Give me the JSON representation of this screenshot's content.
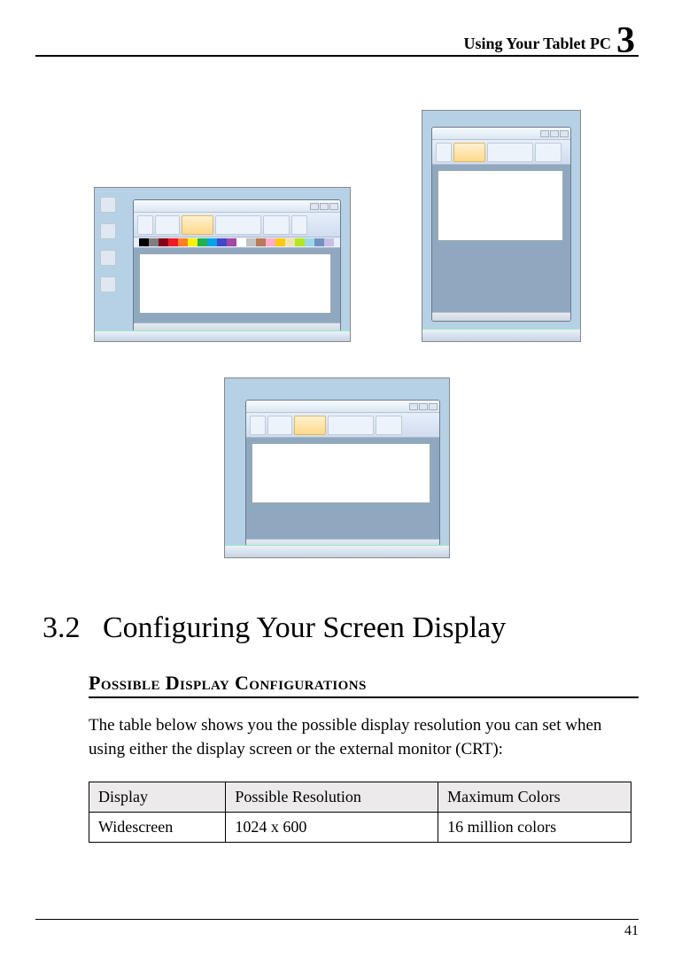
{
  "header": {
    "title": "Using Your Tablet PC",
    "chapter": "3"
  },
  "section": {
    "number": "3.2",
    "title": "Configuring Your Screen Display"
  },
  "subsection": {
    "heading": "Possible Display Configurations"
  },
  "paragraph": "The table below shows you the possible display resolution you can set when using either the display screen or the external monitor (CRT):",
  "table": {
    "headers": [
      "Display",
      "Possible Resolution",
      "Maximum Colors"
    ],
    "rows": [
      [
        "Widescreen",
        "1024 x 600",
        "16 million colors"
      ]
    ]
  },
  "palette_colors": [
    "#000",
    "#7f7f7f",
    "#880015",
    "#ed1c24",
    "#ff7f27",
    "#fff200",
    "#22b14c",
    "#00a2e8",
    "#3f48cc",
    "#a349a4",
    "#fff",
    "#c3c3c3",
    "#b97a57",
    "#ffaec9",
    "#ffc90e",
    "#efe4b0",
    "#b5e61d",
    "#99d9ea",
    "#7092be",
    "#c8bfe7"
  ],
  "page_number": "41"
}
